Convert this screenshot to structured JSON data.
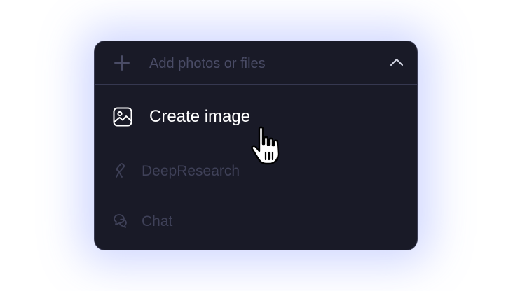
{
  "header": {
    "add_label": "Add photos or files",
    "add_icon": "plus-icon",
    "toggle_icon": "chevron-up-icon"
  },
  "menu": {
    "items": [
      {
        "label": "Create image",
        "icon": "image-icon",
        "state": "highlighted"
      },
      {
        "label": "DeepResearch",
        "icon": "telescope-icon",
        "state": "dimmed"
      },
      {
        "label": "Chat",
        "icon": "chat-bubbles-icon",
        "state": "dimmed"
      }
    ]
  },
  "cursor": {
    "icon": "hand-pointer-icon"
  },
  "colors": {
    "panel_bg": "#191a27",
    "panel_border": "#3b3d55",
    "active_text": "#ffffff",
    "muted_text": "#3f4158",
    "glow": "#788cff"
  }
}
